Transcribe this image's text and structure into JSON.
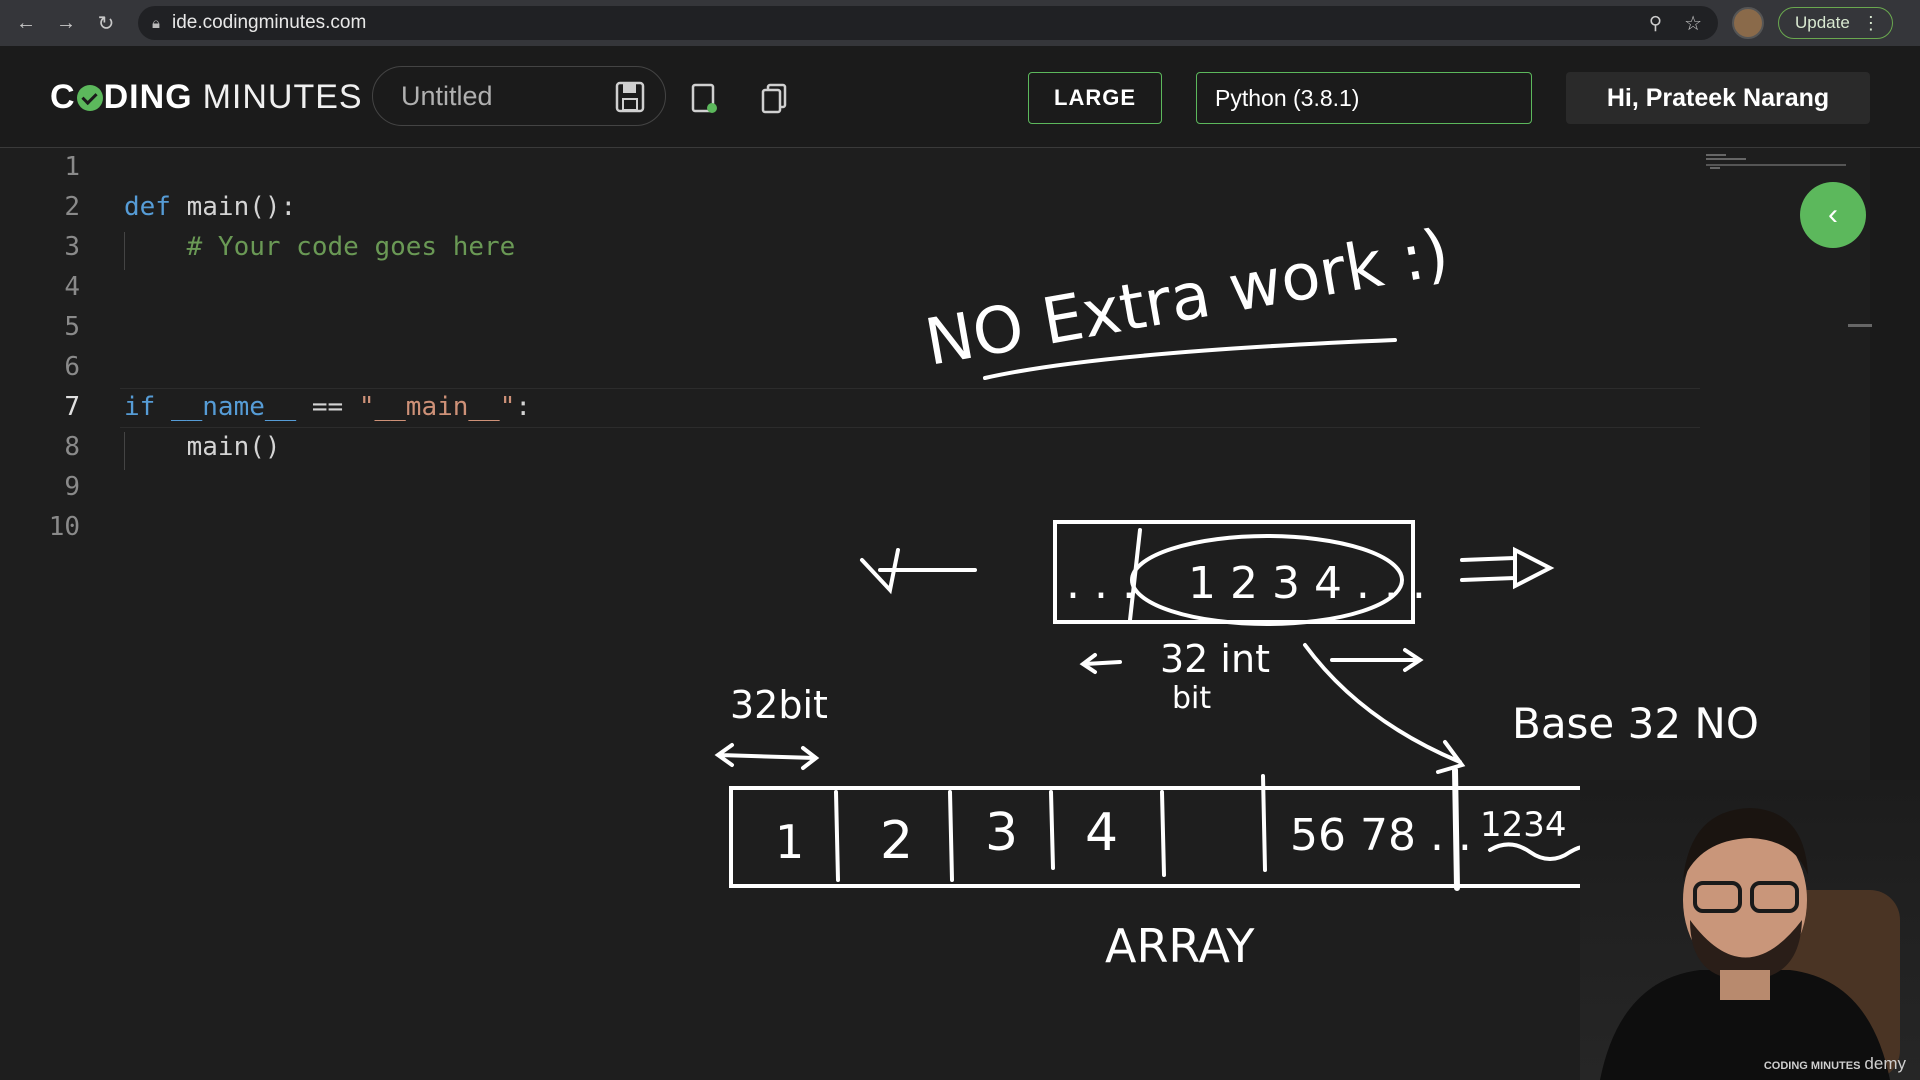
{
  "browser": {
    "url": "ide.codingminutes.com",
    "update_label": "Update"
  },
  "header": {
    "logo_part1": "C",
    "logo_part2": "DING",
    "logo_part3": "MINUTES",
    "file_title": "Untitled",
    "size_button": "LARGE",
    "language": "Python (3.8.1)",
    "greeting": "Hi, Prateek Narang"
  },
  "editor": {
    "line_numbers": [
      "1",
      "2",
      "3",
      "4",
      "5",
      "6",
      "7",
      "8",
      "9",
      "10"
    ],
    "active_line": 7
  },
  "annotations": {
    "headline": "NO Extra work :)",
    "bits_label_top": "32 int",
    "bits_label_bottom": "bit",
    "left_bits": "32bit",
    "base_label": "Base 32 NO",
    "array_label": "ARRAY",
    "box_inner": "1 2 3 4 . . .",
    "box_dots": ". . .",
    "array_cells": [
      "1",
      "2",
      "3",
      "4",
      "",
      "56 78 . .",
      "1234"
    ]
  },
  "webcam": {
    "brand": "CODING MINUTES",
    "watermark": "demy"
  }
}
